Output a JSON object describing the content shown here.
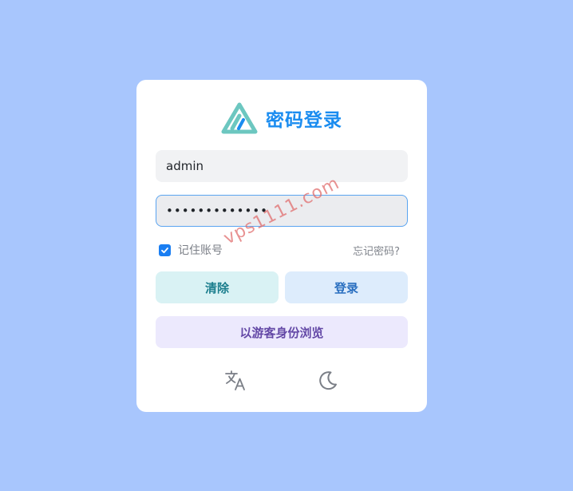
{
  "login": {
    "title": "密码登录",
    "username_value": "admin",
    "password_value": "•••••••••••••",
    "remember_label": "记住账号",
    "remember_checked": true,
    "forgot_label": "忘记密码?",
    "clear_label": "清除",
    "login_label": "登录",
    "guest_label": "以游客身份浏览"
  },
  "icons": {
    "logo": "triangle-logo",
    "language": "translate-icon",
    "theme": "moon-icon"
  },
  "watermark": "vps1111.com",
  "colors": {
    "background": "#a8c6fd",
    "title": "#1a8cf0",
    "logo": "#6cc7c0",
    "checkbox": "#1a7ef2"
  }
}
